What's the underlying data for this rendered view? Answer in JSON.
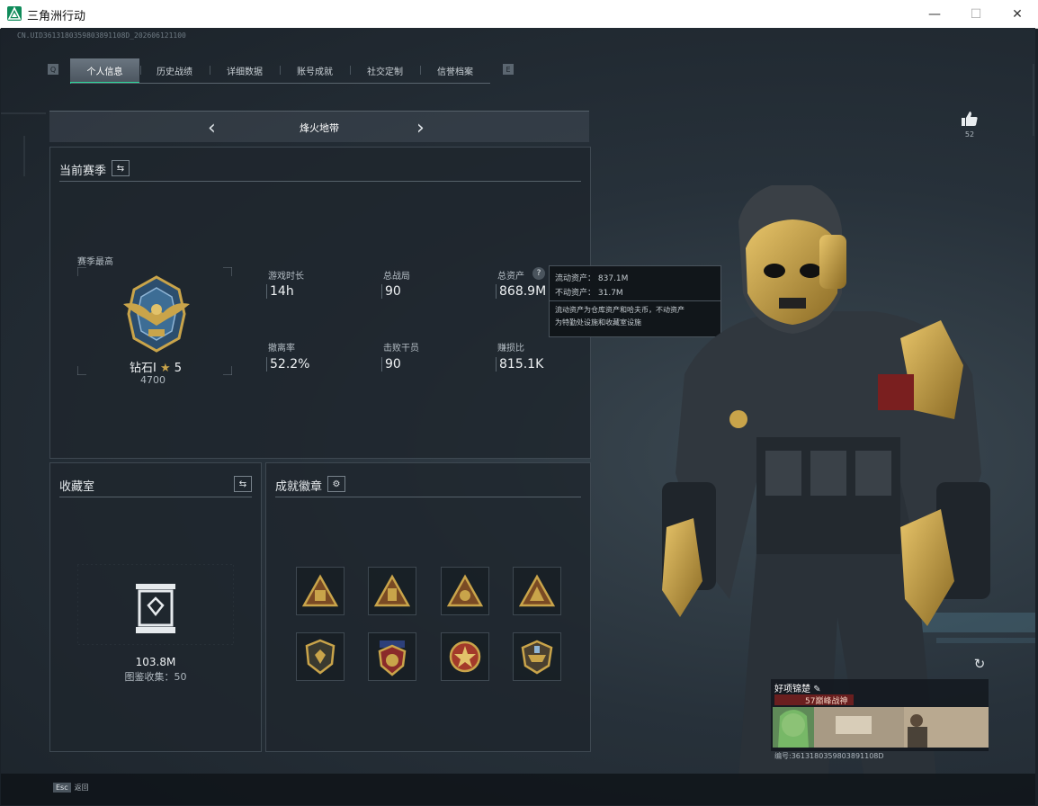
{
  "window": {
    "title": "三角洲行动",
    "minimize": "—",
    "maximize": "☐",
    "close": "✕"
  },
  "version_text": "CN.UID3613180359803891108D_202606121100",
  "tabs": [
    {
      "label": "个人信息",
      "active": true
    },
    {
      "label": "历史战绩",
      "active": false
    },
    {
      "label": "详细数据",
      "active": false
    },
    {
      "label": "账号成就",
      "active": false
    },
    {
      "label": "社交定制",
      "active": false
    },
    {
      "label": "信誉档案",
      "active": false
    }
  ],
  "tab_prev_key": "Q",
  "tab_next_key": "E",
  "mode": {
    "label": "烽火地带"
  },
  "like": {
    "count": "52"
  },
  "season": {
    "title": "当前赛季",
    "rank_caption": "赛季最高",
    "rank_name": "钻石Ⅰ",
    "rank_stars": "5",
    "rank_points": "4700",
    "stats": [
      {
        "label": "游戏时长",
        "value": "14h"
      },
      {
        "label": "总战局",
        "value": "90"
      },
      {
        "label": "总资产",
        "value": "868.9M"
      },
      {
        "label": "撤离率",
        "value": "52.2%"
      },
      {
        "label": "击败干员",
        "value": "90"
      },
      {
        "label": "赚损比",
        "value": "815.1K"
      }
    ]
  },
  "tooltip": {
    "liquid_label": "流动资产：",
    "liquid_value": "837.1M",
    "fixed_label": "不动资产：",
    "fixed_value": "31.7M",
    "desc_line1": "流动资产为仓库资产和哈夫币，不动资产",
    "desc_line2": "为特勤处设施和收藏室设施"
  },
  "collection": {
    "title": "收藏室",
    "value": "103.8M",
    "count_label": "图鉴收集：",
    "count": "50"
  },
  "achievements": {
    "title": "成就徽章",
    "badges": [
      "badge-1",
      "badge-2",
      "badge-3",
      "badge-4",
      "badge-5",
      "badge-6",
      "badge-7",
      "badge-8"
    ]
  },
  "player_card": {
    "name": "好项锦楚",
    "tag": "57巅峰战神",
    "id_text": "编号:3613180359803891108D"
  },
  "footer": {
    "esc_key": "Esc",
    "back_label": "返回"
  },
  "colors": {
    "accent": "#2bd79a",
    "gold": "#c9a44a",
    "panel": "#1e262d"
  }
}
